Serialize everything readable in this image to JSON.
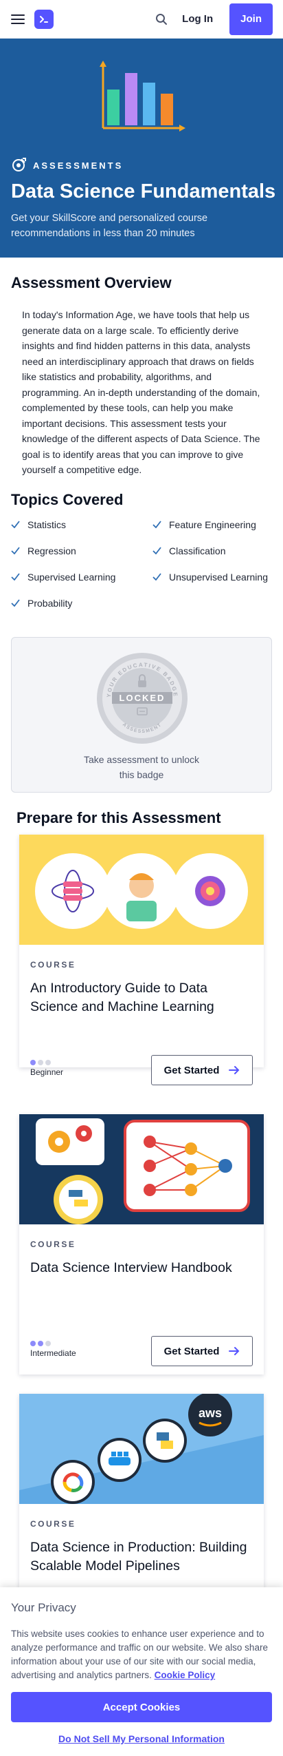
{
  "header": {
    "login_label": "Log In",
    "join_label": "Join"
  },
  "hero": {
    "kicker": "ASSESSMENTS",
    "title": "Data Science Fundamentals",
    "subtitle": "Get your SkillScore and personalized course recommendations in less than 20 minutes"
  },
  "overview": {
    "title": "Assessment Overview",
    "text": "In today's Information Age, we have tools that help us generate data on a large scale. To efficiently derive insights and find hidden patterns in this data, analysts need an interdisciplinary approach that draws on fields like statistics and probability, algorithms, and programming. An in-depth understanding of the domain, complemented by these tools, can help you make important decisions. This assessment tests your knowledge of the different aspects of Data Science. The goal is to identify areas that you can improve to give yourself a competitive edge."
  },
  "topics": {
    "title": "Topics Covered",
    "items": [
      "Statistics",
      "Feature Engineering",
      "Regression",
      "Classification",
      "Supervised Learning",
      "Unsupervised Learning",
      "Probability"
    ]
  },
  "badge": {
    "ring_top": "YOUR EDUCATIVE BADGE",
    "ring_bottom": "ASSESSMENT",
    "status": "LOCKED",
    "caption": "Take assessment to unlock this badge"
  },
  "prepare": {
    "title": "Prepare for this Assessment",
    "courses": [
      {
        "kicker": "COURSE",
        "title": "An Introductory Guide to Data Science and Machine Learning",
        "level": "Beginner",
        "level_value": 1,
        "level_max": 3,
        "cta": "Get Started"
      },
      {
        "kicker": "COURSE",
        "title": "Data Science Interview Handbook",
        "level": "Intermediate",
        "level_value": 2,
        "level_max": 3,
        "cta": "Get Started"
      },
      {
        "kicker": "COURSE",
        "title": "Data Science in Production: Building Scalable Model Pipelines"
      }
    ]
  },
  "aws_label": "aws",
  "privacy": {
    "title": "Your Privacy",
    "text": "This website uses cookies to enhance user experience and to analyze performance and traffic on our website. We also share information about your use of our site with our social media, advertising and analytics partners.",
    "policy_link": "Cookie Policy",
    "accept_label": "Accept Cookies",
    "do_not_sell_label": "Do Not Sell My Personal Information"
  },
  "colors": {
    "brand": "#5553ff",
    "hero_bg": "#1d5c9c"
  }
}
